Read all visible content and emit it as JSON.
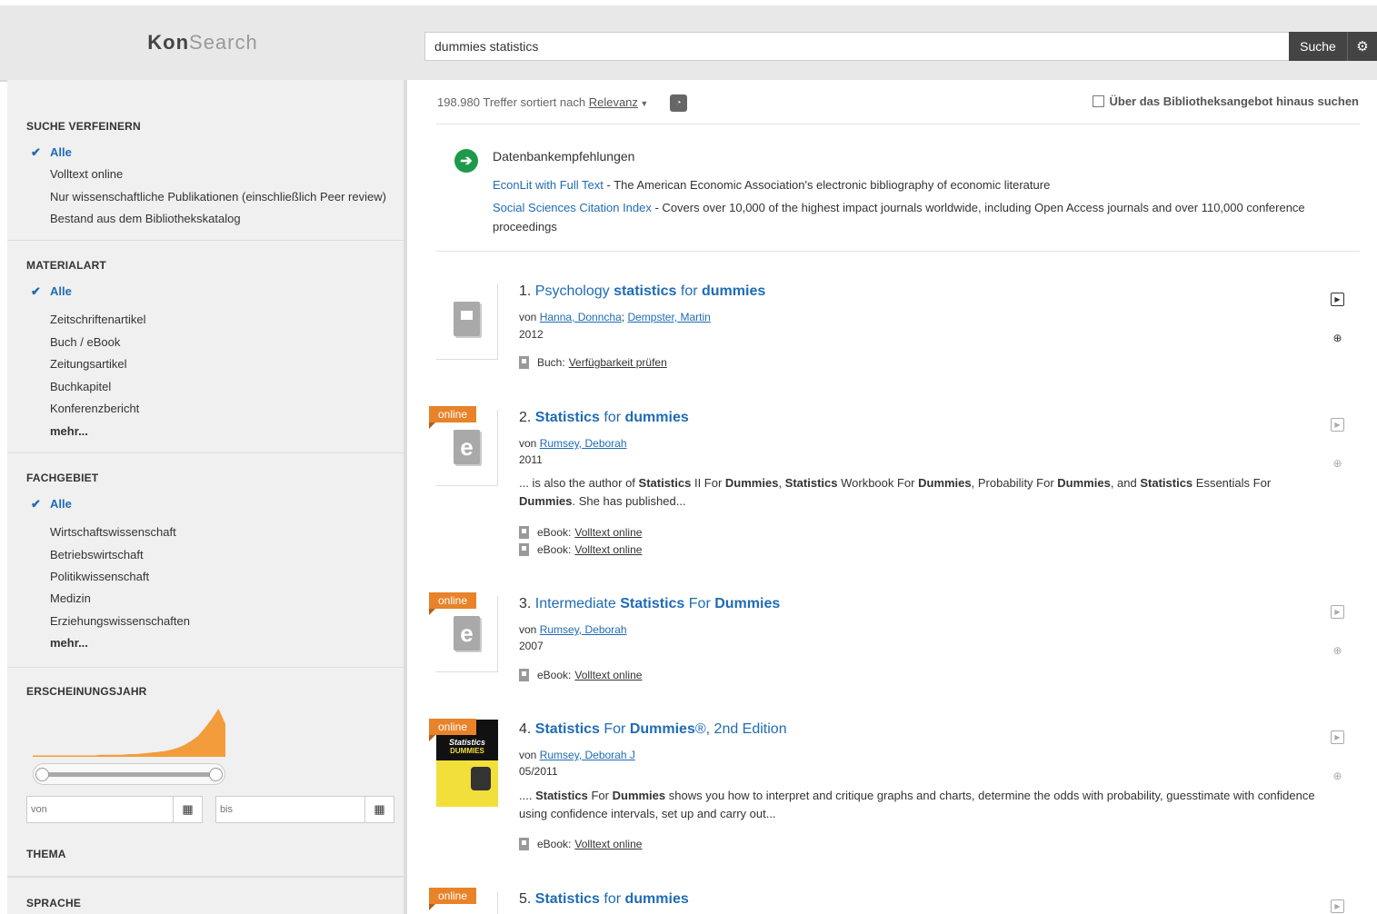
{
  "header": {
    "logo_bold": "Kon",
    "logo_light": "Search",
    "query": "dummies statistics",
    "search_label": "Suche",
    "settings_icon": "gear-icon"
  },
  "sidebar": {
    "refine": {
      "title": "SUCHE VERFEINERN",
      "items": [
        "Alle",
        "Volltext online",
        "Nur wissenschaftliche Publikationen (einschließlich Peer review)",
        "Bestand aus dem Bibliothekskatalog"
      ]
    },
    "material": {
      "title": "MATERIALART",
      "items": [
        "Alle",
        "Zeitschriftenartikel",
        "Buch / eBook",
        "Zeitungsartikel",
        "Buchkapitel",
        "Konferenzbericht",
        "mehr..."
      ]
    },
    "subject": {
      "title": "FACHGEBIET",
      "items": [
        "Alle",
        "Wirtschaftswissenschaft",
        "Betriebswirtschaft",
        "Politikwissenschaft",
        "Medizin",
        "Erziehungswissenschaften",
        "mehr..."
      ]
    },
    "year": {
      "title": "ERSCHEINUNGSJAHR",
      "from_placeholder": "von",
      "to_placeholder": "bis",
      "histogram": [
        2,
        2,
        2,
        2,
        2,
        2,
        2,
        2,
        2,
        2,
        3,
        3,
        3,
        3,
        4,
        4,
        5,
        6,
        7,
        8,
        10,
        13,
        17,
        23,
        30,
        42,
        55,
        70,
        48
      ],
      "slider_range": [
        0,
        1
      ]
    },
    "theme": {
      "title": "THEMA"
    },
    "language": {
      "title": "SPRACHE"
    }
  },
  "results_bar": {
    "hits_text": "198.980 Treffer sortiert nach",
    "sort_label": "Relevanz",
    "beyond_label": "Über das Bibliotheksangebot hinaus suchen"
  },
  "recommendations": {
    "title": "Datenbankempfehlungen",
    "items": [
      {
        "name": "EconLit with Full Text",
        "desc": " - The American Economic Association's electronic bibliography of economic literature"
      },
      {
        "name": "Social Sciences Citation Index",
        "desc": " - Covers over 10,000 of the highest impact journals worldwide, including Open Access journals and over 110,000 conference proceedings"
      }
    ]
  },
  "results": [
    {
      "num": "1. ",
      "title_parts": [
        "Psychology ",
        "statistics",
        " for ",
        "dummies",
        ""
      ],
      "by": "von",
      "authors": [
        "Hanna, Donncha",
        "Dempster, Martin"
      ],
      "year": "2012",
      "links": [
        {
          "type": "Buch:",
          "label": "Verfügbarkeit prüfen"
        }
      ]
    },
    {
      "num": "2. ",
      "online": "online",
      "title_parts": [
        "",
        "Statistics",
        " for ",
        "dummies",
        ""
      ],
      "by": "von",
      "authors": [
        "Rumsey, Deborah"
      ],
      "year": "2011",
      "snippet_html": "... is also the author of <b>Statistics</b> II For <b>Dummies</b>, <b>Statistics</b> Workbook For <b>Dummies</b>, Probability For <b>Dummies</b>, and <b>Statistics</b> Essentials For <b>Dummies</b>. She has published...",
      "links": [
        {
          "type": "eBook:",
          "label": "Volltext online"
        },
        {
          "type": "eBook:",
          "label": "Volltext online"
        }
      ]
    },
    {
      "num": "3. ",
      "online": "online",
      "title_parts": [
        "Intermediate ",
        "Statistics",
        " For ",
        "Dummies",
        ""
      ],
      "by": "von",
      "authors": [
        "Rumsey, Deborah"
      ],
      "year": "2007",
      "links": [
        {
          "type": "eBook:",
          "label": "Volltext online"
        }
      ]
    },
    {
      "num": "4. ",
      "online": "online",
      "title_parts": [
        "",
        "Statistics",
        " For ",
        "Dummies",
        "®, 2nd Edition"
      ],
      "by": "von",
      "authors": [
        "Rumsey, Deborah J"
      ],
      "year": "05/2011",
      "cover": {
        "line1": "Statistics",
        "line2": "DUMMIES"
      },
      "snippet_html": ".... <b>Statistics</b> For <b>Dummies</b> shows you how to interpret and critique graphs and charts, determine the odds with probability, guesstimate with confidence using confidence intervals, set up and carry out...",
      "links": [
        {
          "type": "eBook:",
          "label": "Volltext online"
        }
      ]
    },
    {
      "num": "5. ",
      "online": "online",
      "title_parts": [
        "",
        "Statistics",
        " for ",
        "dummies",
        ""
      ]
    }
  ],
  "colors": {
    "accent": "#1f6bb5",
    "online": "#e8832a",
    "recommend": "#1c9a4a",
    "chart": "#f39c3c"
  }
}
